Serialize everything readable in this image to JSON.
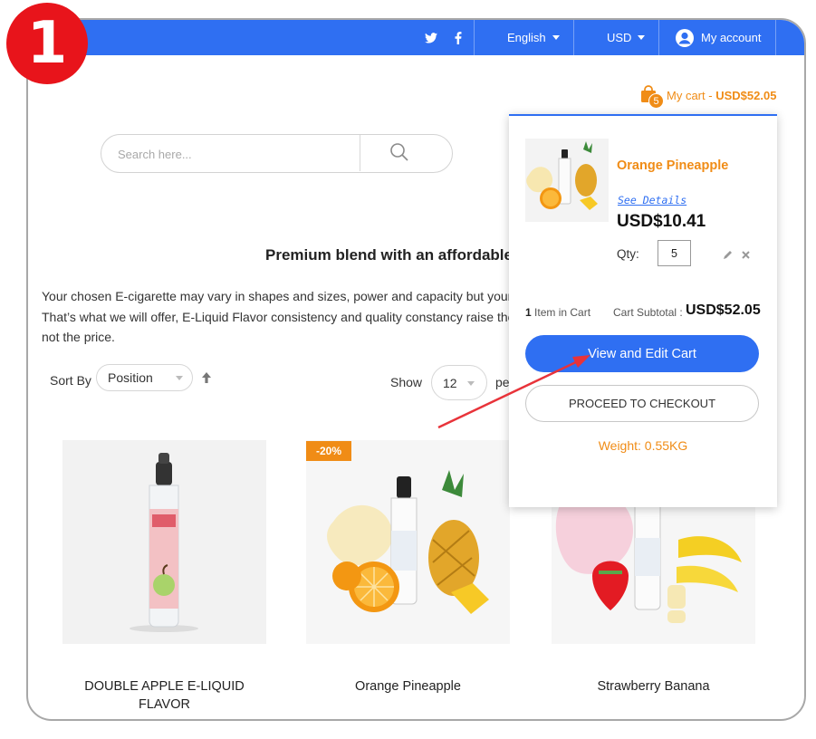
{
  "step_number": "1",
  "topbar": {
    "twitter_icon": "twitter-icon",
    "facebook_icon": "facebook-icon",
    "language": "English",
    "currency": "USD",
    "account_label": "My account"
  },
  "header": {
    "cart_label": "My cart",
    "cart_separator": "-",
    "cart_total": "USD$52.05",
    "cart_count": "5"
  },
  "search": {
    "placeholder": "Search here..."
  },
  "main": {
    "heading": "Premium blend with an affordable",
    "description": "Your chosen E-cigarette may vary in shapes and sizes, power and capacity but your taste. – That’s what we will offer, E-Liquid Flavor consistency and quality constancy raise the standards, not the price.",
    "sort_label": "Sort By",
    "sort_value": "Position",
    "show_label": "Show",
    "show_value": "12",
    "per_label": "pe"
  },
  "products": [
    {
      "name": "DOUBLE APPLE E-LIQUID FLAVOR",
      "badge": ""
    },
    {
      "name": "Orange Pineapple",
      "badge": "-20%"
    },
    {
      "name": "Strawberry Banana",
      "badge": ""
    }
  ],
  "minicart": {
    "item_name": "Orange Pineapple",
    "see_details": "See Details",
    "item_price": "USD$10.41",
    "qty_label": "Qty:",
    "qty_value": "5",
    "items_count": "1",
    "items_label": "Item in Cart",
    "subtotal_label": "Cart Subtotal :",
    "subtotal_value": "USD$52.05",
    "view_cart_label": "View and Edit Cart",
    "checkout_label": "PROCEED TO CHECKOUT",
    "weight_text": "Weight: 0.55KG"
  },
  "colors": {
    "brand_blue": "#2f6ff2",
    "accent_orange": "#f08c16",
    "step_red": "#e8141b"
  }
}
